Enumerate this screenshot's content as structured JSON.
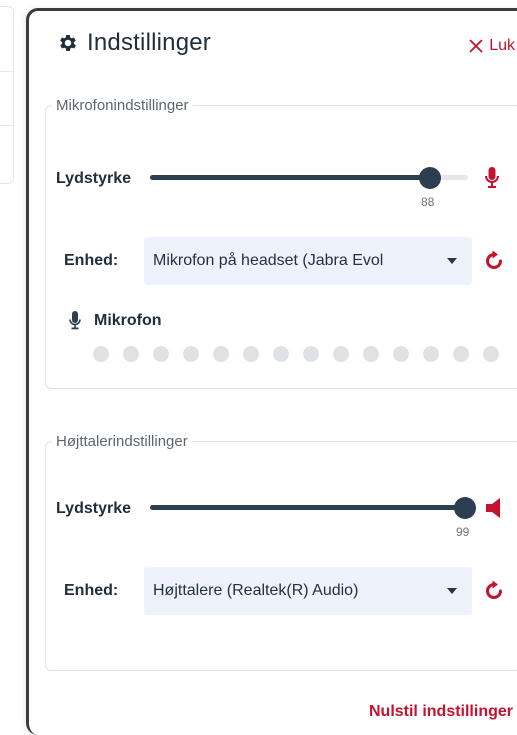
{
  "panel": {
    "title": "Indstillinger",
    "close_label": "Luk",
    "reset_label": "Nulstil indstillinger"
  },
  "microphone": {
    "legend": "Mikrofonindstillinger",
    "volume_label": "Lydstyrke",
    "volume_value": 88,
    "volume_display": "88",
    "device_label": "Enhed:",
    "device_value": "Mikrofon på headset (Jabra Evol",
    "meter_label": "Mikrofon",
    "meter_dots": 14,
    "meter_active": 0
  },
  "speaker": {
    "legend": "Højttalerindstillinger",
    "volume_label": "Lydstyrke",
    "volume_value": 99,
    "volume_display": "99",
    "device_label": "Enhed:",
    "device_value": "Højttalere (Realtek(R) Audio)"
  },
  "colors": {
    "accent_red": "#c4122f",
    "slider_fill": "#2c3e50",
    "select_bg": "#eef2fb"
  },
  "icons": {
    "header": "gear-icon",
    "close": "x-icon",
    "mic_mute": "microphone-icon",
    "speaker_mute": "speaker-icon",
    "reset": "refresh-icon",
    "dropdown": "caret-down-icon"
  }
}
